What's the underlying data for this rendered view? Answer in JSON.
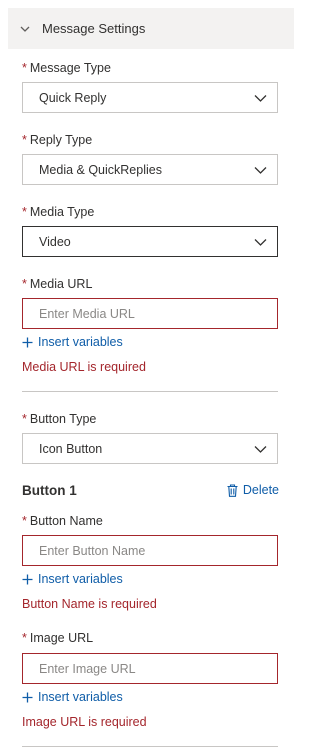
{
  "section": {
    "title": "Message Settings"
  },
  "message_type": {
    "label": "Message Type",
    "required": "*",
    "value": "Quick Reply"
  },
  "reply_type": {
    "label": "Reply Type",
    "required": "*",
    "value": "Media & QuickReplies"
  },
  "media_type": {
    "label": "Media Type",
    "required": "*",
    "value": "Video"
  },
  "media_url": {
    "label": "Media URL",
    "required": "*",
    "placeholder": "Enter Media URL",
    "insert_label": "Insert variables",
    "error": "Media URL is required"
  },
  "button_type": {
    "label": "Button Type",
    "required": "*",
    "value": "Icon Button"
  },
  "button1": {
    "title": "Button 1",
    "delete_label": "Delete",
    "name": {
      "label": "Button Name",
      "required": "*",
      "placeholder": "Enter Button Name",
      "insert_label": "Insert variables",
      "error": "Button Name is required"
    },
    "image": {
      "label": "Image URL",
      "required": "*",
      "placeholder": "Enter Image URL",
      "insert_label": "Insert variables",
      "error": "Image URL is required"
    }
  },
  "colors": {
    "error": "#a4262c",
    "link": "#0f5da8",
    "header_bg": "#f3f2f1"
  },
  "icons": {
    "section_toggle": "chevron-down-icon",
    "select_caret": "chevron-down-icon",
    "insert": "plus-icon",
    "delete": "trash-icon"
  }
}
